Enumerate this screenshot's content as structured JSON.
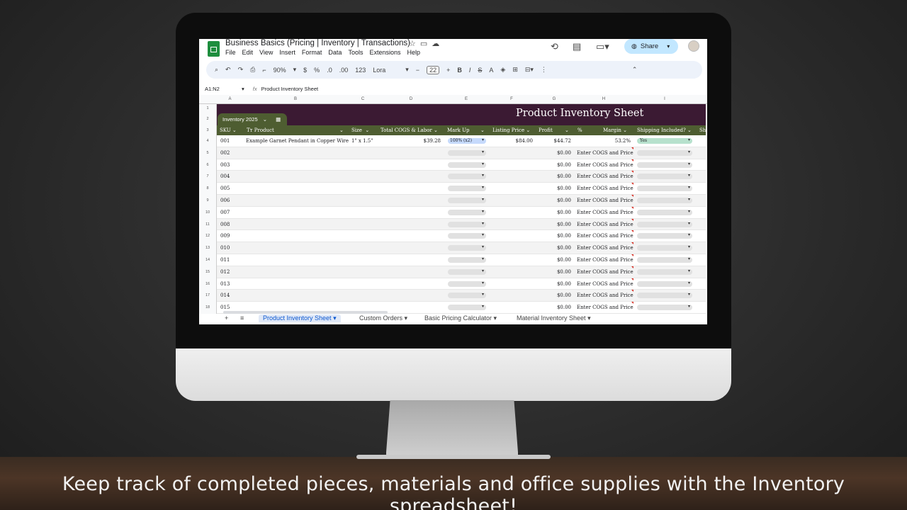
{
  "caption": "Keep track of completed pieces, materials and office supplies with the Inventory spreadsheet!",
  "app": {
    "doc_title": "Business Basics (Pricing | Inventory | Transactions)",
    "doc_icons": [
      "star-icon",
      "folder-move-icon",
      "cloud-status-icon"
    ],
    "menu": [
      "File",
      "Edit",
      "View",
      "Insert",
      "Format",
      "Data",
      "Tools",
      "Extensions",
      "Help"
    ],
    "share_label": "Share"
  },
  "toolbar": {
    "zoom": "90%",
    "currency": "$",
    "percent": "%",
    "decrease_decimal": ".0",
    "increase_decimal": ".00",
    "number_format": "123",
    "font": "Lora",
    "font_size": "22",
    "bold": "B",
    "italic": "I",
    "strike": "S",
    "text_color": "A"
  },
  "formula_bar": {
    "cell_ref": "A1:N2",
    "fx": "fx",
    "content": "Product Inventory Sheet"
  },
  "grid": {
    "columns": [
      "A",
      "B",
      "C",
      "D",
      "E",
      "F",
      "G",
      "H",
      "I"
    ],
    "row_numbers": [
      "1",
      "2",
      "3",
      "4",
      "5",
      "6",
      "7",
      "8",
      "9",
      "10",
      "11",
      "12",
      "13",
      "14",
      "15",
      "16",
      "17",
      "18"
    ],
    "banner_title": "Product Inventory Sheet",
    "table_tab": "Inventory 2025",
    "headers": [
      "SKU",
      "Product",
      "Size",
      "Total COGS & Labor",
      "Mark Up",
      "Listing Price",
      "Profit",
      "%",
      "Margin",
      "Shipping Included?",
      "Sh"
    ],
    "first_row": {
      "sku": "001",
      "product": "Example Garnet Pendant in Copper Wire",
      "size": "1\" x 1.5\"",
      "cogs": "$39.28",
      "markup": "100% (x2)",
      "listing_price": "$84.00",
      "profit": "$44.72",
      "margin": "53.2%",
      "shipping": "Yes"
    },
    "empty_skus": [
      "002",
      "003",
      "004",
      "005",
      "006",
      "007",
      "008",
      "009",
      "010",
      "011",
      "012",
      "013",
      "014",
      "015"
    ],
    "empty_profit": "$0.00",
    "empty_margin": "Enter COGS and Price"
  },
  "sheet_tabs": {
    "add": "+",
    "all_sheets": "≡",
    "tabs": [
      "Product Inventory Sheet",
      "Custom Orders",
      "Basic Pricing Calculator",
      "Material Inventory Sheet"
    ]
  },
  "colors": {
    "banner": "#3b1a33",
    "header_row": "#4e5d31",
    "share_bg": "#c2e7ff",
    "chip_yes": "#b7e1cd",
    "chip_markup": "#c6dafc"
  }
}
